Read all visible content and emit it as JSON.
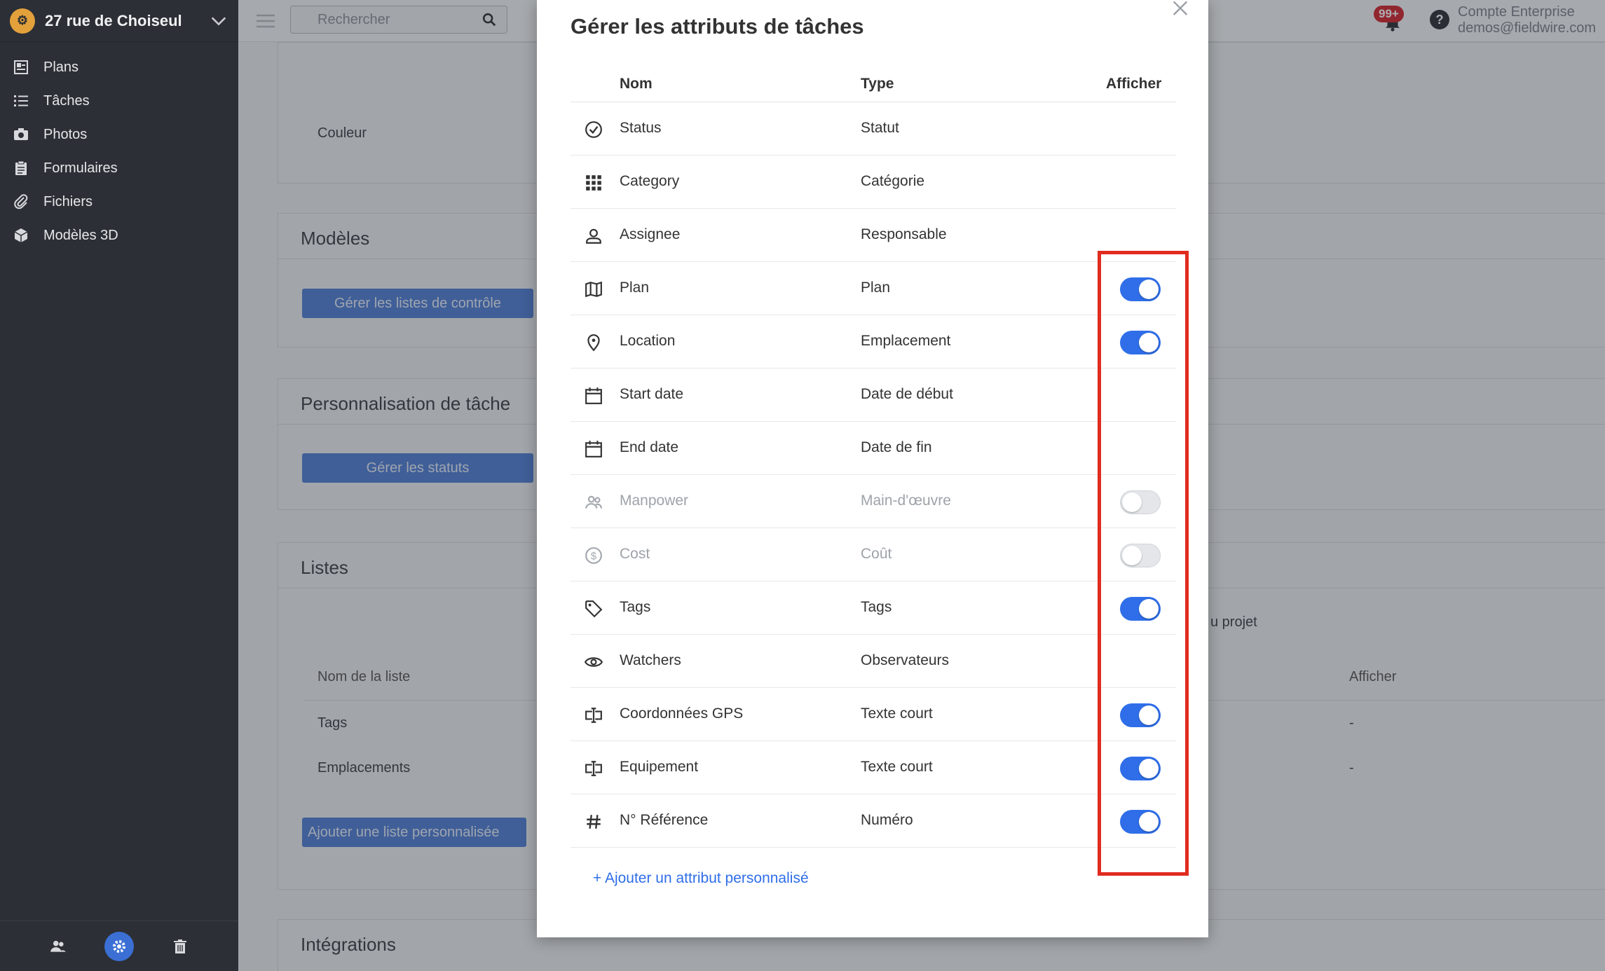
{
  "sidebar": {
    "project_name": "27 rue de Choiseul",
    "items": [
      {
        "label": "Plans",
        "icon": "plans-icon"
      },
      {
        "label": "Tâches",
        "icon": "tasks-icon"
      },
      {
        "label": "Photos",
        "icon": "camera-icon"
      },
      {
        "label": "Formulaires",
        "icon": "clipboard-icon"
      },
      {
        "label": "Fichiers",
        "icon": "paperclip-icon"
      },
      {
        "label": "Modèles 3D",
        "icon": "cube-icon"
      }
    ],
    "bottom_icons": [
      "people-icon",
      "gear-icon",
      "trash-icon"
    ]
  },
  "topbar": {
    "search_placeholder": "Rechercher",
    "notif_badge": "99+",
    "help": "?",
    "account_name": "Compte Enterprise",
    "account_email": "demos@fieldwire.com"
  },
  "background": {
    "couleur_label": "Couleur",
    "modeles_title": "Modèles",
    "checklist_button": "Gérer les listes de contrôle",
    "perso_title": "Personnalisation de tâche",
    "statuses_button": "Gérer les statuts",
    "listes_title": "Listes",
    "projet_text": "u projet",
    "list_header_name": "Nom de la liste",
    "list_header_show": "Afficher",
    "list_rows": [
      {
        "name": "Tags",
        "show": "-"
      },
      {
        "name": "Emplacements",
        "show": "-"
      }
    ],
    "add_list_button": "Ajouter une liste personnalisée",
    "integrations_title": "Intégrations"
  },
  "modal": {
    "title": "Gérer les attributs de tâches",
    "headers": {
      "name": "Nom",
      "type": "Type",
      "show": "Afficher"
    },
    "rows": [
      {
        "name": "Status",
        "type": "Statut",
        "icon": "check-circle-icon",
        "toggle": null,
        "dim": false
      },
      {
        "name": "Category",
        "type": "Catégorie",
        "icon": "grid-icon",
        "toggle": null,
        "dim": false
      },
      {
        "name": "Assignee",
        "type": "Responsable",
        "icon": "person-icon",
        "toggle": null,
        "dim": false
      },
      {
        "name": "Plan",
        "type": "Plan",
        "icon": "map-icon",
        "toggle": true,
        "dim": false
      },
      {
        "name": "Location",
        "type": "Emplacement",
        "icon": "pin-icon",
        "toggle": true,
        "dim": false
      },
      {
        "name": "Start date",
        "type": "Date de début",
        "icon": "calendar-icon",
        "toggle": null,
        "dim": false
      },
      {
        "name": "End date",
        "type": "Date de fin",
        "icon": "calendar-icon",
        "toggle": null,
        "dim": false
      },
      {
        "name": "Manpower",
        "type": "Main-d'œuvre",
        "icon": "people-icon",
        "toggle": false,
        "dim": true
      },
      {
        "name": "Cost",
        "type": "Coût",
        "icon": "dollar-circle-icon",
        "toggle": false,
        "dim": true
      },
      {
        "name": "Tags",
        "type": "Tags",
        "icon": "tag-icon",
        "toggle": true,
        "dim": false
      },
      {
        "name": "Watchers",
        "type": "Observateurs",
        "icon": "eye-icon",
        "toggle": null,
        "dim": false
      },
      {
        "name": "Coordonnées GPS",
        "type": "Texte court",
        "icon": "text-field-icon",
        "toggle": true,
        "dim": false
      },
      {
        "name": "Equipement",
        "type": "Texte court",
        "icon": "text-field-icon",
        "toggle": true,
        "dim": false
      },
      {
        "name": "N° Référence",
        "type": "Numéro",
        "icon": "hash-icon",
        "toggle": true,
        "dim": false
      }
    ],
    "add_attribute": "+ Ajouter un attribut personnalisé"
  },
  "colors": {
    "accent": "#2f6ee8",
    "highlight": "#e12b1f",
    "sidebar": "#2c2f35"
  }
}
